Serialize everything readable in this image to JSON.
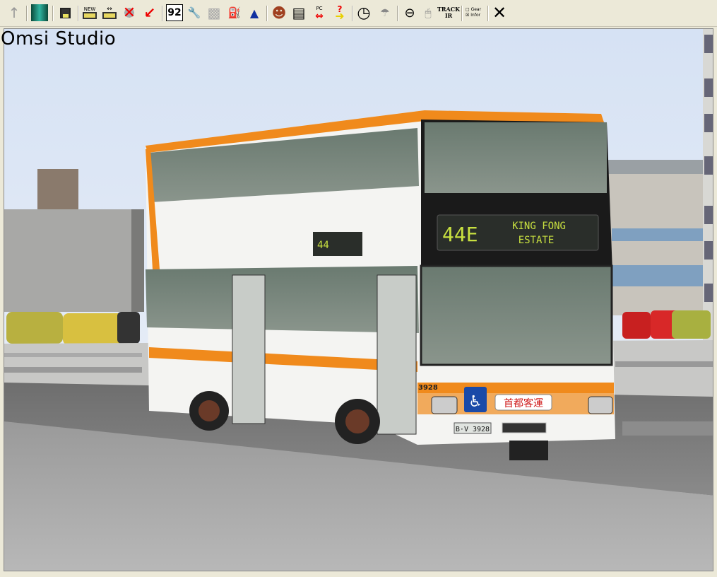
{
  "window": {
    "title": "Omsi Studio"
  },
  "toolbar": {
    "items": [
      {
        "name": "up-arrow",
        "glyph": "↑"
      },
      {
        "name": "map-view",
        "glyph": "▦"
      },
      {
        "name": "save",
        "glyph": "💾"
      },
      {
        "name": "new-bus",
        "label": "NEW"
      },
      {
        "name": "swap-bus",
        "label": "↔"
      },
      {
        "name": "delete-bus",
        "glyph": "✕"
      },
      {
        "name": "place-pointer",
        "glyph": "↙"
      },
      {
        "name": "display-number",
        "label": "92"
      },
      {
        "name": "wrench",
        "glyph": "🔧"
      },
      {
        "name": "engine",
        "glyph": "▩"
      },
      {
        "name": "fuel",
        "glyph": "⛽"
      },
      {
        "name": "bell",
        "glyph": "▲"
      },
      {
        "name": "driver",
        "glyph": "☻"
      },
      {
        "name": "timetable",
        "glyph": "▤"
      },
      {
        "name": "pc-driver-swap",
        "label": "PC"
      },
      {
        "name": "help-arrow",
        "glyph": "?"
      },
      {
        "name": "clock",
        "glyph": "◷"
      },
      {
        "name": "weather",
        "glyph": "☂"
      },
      {
        "name": "steering-wheel",
        "glyph": "⊖"
      },
      {
        "name": "mouse",
        "glyph": "🖱"
      },
      {
        "name": "track-ir",
        "label": "TRACK IR"
      },
      {
        "name": "options",
        "label": "□ Gear ☒ Infor"
      },
      {
        "name": "close",
        "glyph": "✕"
      }
    ]
  },
  "bus": {
    "route": "44E",
    "destination_line1": "KING FONG",
    "destination_line2": "ESTATE",
    "side_route": "44",
    "fleet_number": "3928",
    "operator_name": "首都客運",
    "plate": "B·V 3928"
  },
  "colors": {
    "bus_orange": "#f08a1c",
    "bus_white": "#f4f4f2",
    "display_text": "#c8e040",
    "sky": "#dce6f4"
  }
}
